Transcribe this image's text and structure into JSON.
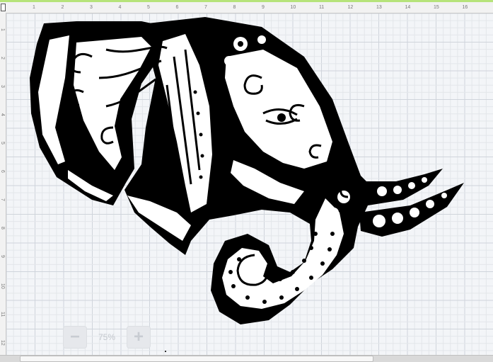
{
  "ruler": {
    "h_numbers": [
      "1",
      "2",
      "3",
      "4",
      "5",
      "6",
      "7",
      "8",
      "9",
      "10",
      "11",
      "12",
      "13",
      "14",
      "15",
      "16"
    ],
    "v_numbers": [
      "1",
      "2",
      "3",
      "4",
      "5",
      "6",
      "7",
      "8",
      "9",
      "10",
      "11",
      "12"
    ]
  },
  "zoom": {
    "minus_label": "−",
    "value": "75%",
    "plus_label": "+"
  },
  "artwork": {
    "icon": "elephant-mandala-icon"
  },
  "colors": {
    "canvas_bg": "#f3f5f8",
    "grid": "#d9dde3",
    "ink": "#000000",
    "accent": "#b6e37a"
  }
}
